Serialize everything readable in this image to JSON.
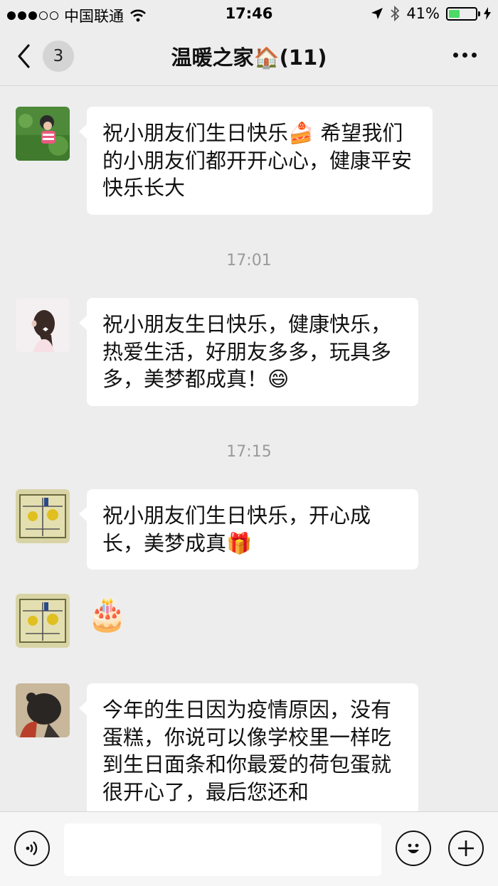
{
  "status_bar": {
    "carrier": "中国联通",
    "time": "17:46",
    "battery_percent": "41%",
    "battery_level": 0.41
  },
  "nav": {
    "unread_count": "3",
    "title": "温暖之家🏠(11)"
  },
  "messages": [
    {
      "text": "祝小朋友们生日快乐🍰 希望我们的小朋友们都开开心心，健康平安快乐长大"
    },
    {
      "text": "祝小朋友生日快乐，健康快乐，热爱生活，好朋友多多，玩具多多，美梦都成真！😄"
    },
    {
      "text": "祝小朋友们生日快乐，开心成长，美梦成真🎁"
    },
    {
      "text": "🎂"
    },
    {
      "text": "今年的生日因为疫情原因，没有蛋糕，你说可以像学校里一样吃到生日面条和你最爱的荷包蛋就很开心了，最后您还和"
    }
  ],
  "timestamps": [
    "17:01",
    "17:15"
  ],
  "input": {
    "placeholder": ""
  },
  "colors": {
    "background": "#ededed",
    "bubble": "#ffffff",
    "battery": "#4cd964"
  }
}
